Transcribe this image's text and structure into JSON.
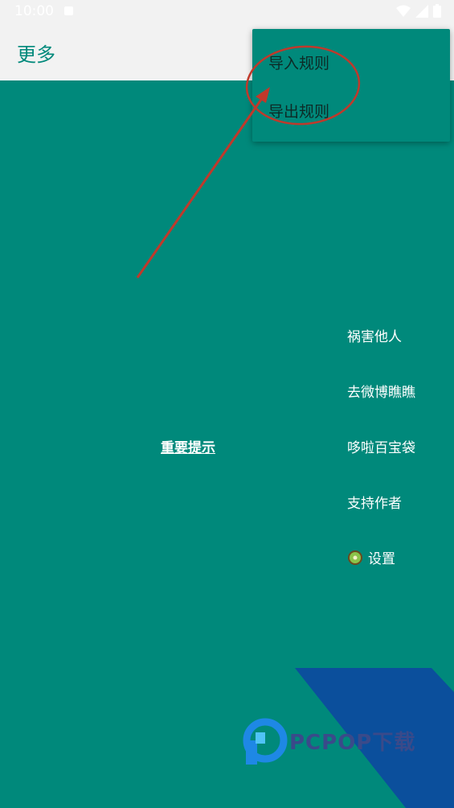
{
  "status_bar": {
    "time": "10:00",
    "icons": [
      "notification-icon",
      "wifi-icon",
      "signal-icon",
      "battery-icon"
    ]
  },
  "app_bar": {
    "title": "更多"
  },
  "popup_menu": {
    "items": [
      {
        "label": "导入规则"
      },
      {
        "label": "导出规则"
      }
    ]
  },
  "main": {
    "center_link": "重要提示",
    "side_menu": [
      {
        "label": "祸害他人"
      },
      {
        "label": "去微博瞧瞧"
      },
      {
        "label": "哆啦百宝袋"
      },
      {
        "label": "支持作者"
      },
      {
        "label": "设置",
        "icon": "kiwi-icon"
      }
    ]
  },
  "watermark": {
    "text": "PCPOP下载"
  },
  "colors": {
    "primary": "#00897b",
    "app_bar_bg": "#f2f2f2",
    "annotation": "#c0392b",
    "watermark_blue": "#0b4f9c"
  }
}
